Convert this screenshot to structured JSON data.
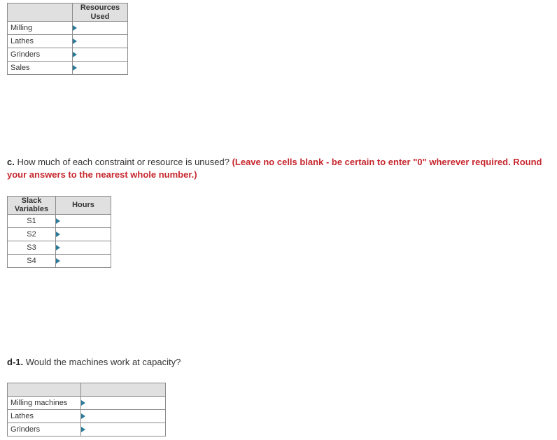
{
  "table1": {
    "headers": {
      "col1": "",
      "col2": "Resources\nUsed"
    },
    "rows": [
      {
        "label": "Milling",
        "value": ""
      },
      {
        "label": "Lathes",
        "value": ""
      },
      {
        "label": "Grinders",
        "value": ""
      },
      {
        "label": "Sales",
        "value": ""
      }
    ]
  },
  "question_c": {
    "label": "c.",
    "text": " How much of each constraint or resource is unused? ",
    "instruction": "(Leave no cells blank - be certain to enter \"0\" wherever required. Round your answers to the nearest whole number.)"
  },
  "table2": {
    "headers": {
      "col1": "Slack\nVariables",
      "col2": "Hours"
    },
    "rows": [
      {
        "label": "S1",
        "value": ""
      },
      {
        "label": "S2",
        "value": ""
      },
      {
        "label": "S3",
        "value": ""
      },
      {
        "label": "S4",
        "value": ""
      }
    ]
  },
  "question_d1": {
    "label": "d-1.",
    "text": " Would the machines work at capacity?"
  },
  "table3": {
    "headers": {
      "col1": "",
      "col2": ""
    },
    "rows": [
      {
        "label": "Milling machines",
        "value": ""
      },
      {
        "label": "Lathes",
        "value": ""
      },
      {
        "label": "Grinders",
        "value": ""
      }
    ]
  }
}
